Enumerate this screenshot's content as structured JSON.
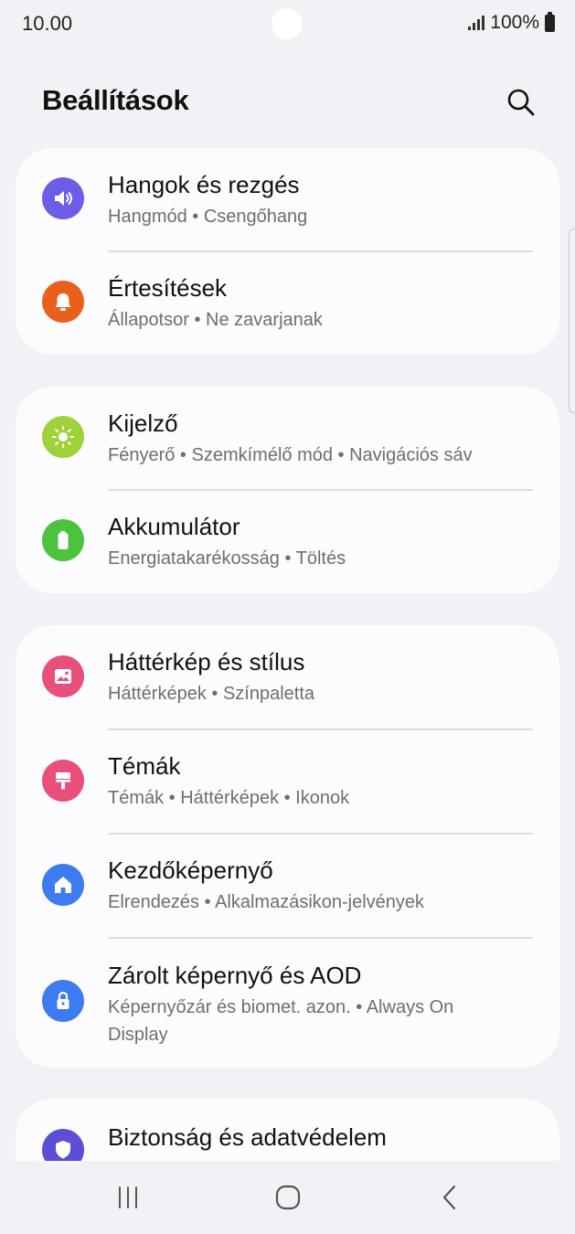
{
  "status_bar": {
    "time": "10.00",
    "battery": "100%"
  },
  "header": {
    "title": "Beállítások"
  },
  "groups": [
    {
      "items": [
        {
          "title": "Hangok és rezgés",
          "subtitle": "Hangmód  •  Csengőhang",
          "icon": "volume-icon",
          "color": "#6c5ce7"
        },
        {
          "title": "Értesítések",
          "subtitle": "Állapotsor  •  Ne zavarjanak",
          "icon": "bell-icon",
          "color": "#e8601c"
        }
      ]
    },
    {
      "items": [
        {
          "title": "Kijelző",
          "subtitle": "Fényerő  •  Szemkímélő mód  •  Navigációs sáv",
          "icon": "brightness-icon",
          "color": "#9fd23a"
        },
        {
          "title": "Akkumulátor",
          "subtitle": "Energiatakarékosság  •  Töltés",
          "icon": "battery-icon",
          "color": "#4cc23e"
        }
      ]
    },
    {
      "items": [
        {
          "title": "Háttérkép és stílus",
          "subtitle": "Háttérképek  •  Színpaletta",
          "icon": "image-icon",
          "color": "#e84f7a"
        },
        {
          "title": "Témák",
          "subtitle": "Témák  •  Háttérképek  •  Ikonok",
          "icon": "paintbrush-icon",
          "color": "#e84f7a"
        },
        {
          "title": "Kezdőképernyő",
          "subtitle": "Elrendezés  •  Alkalmazásikon-jelvények",
          "icon": "home-icon",
          "color": "#3d7cf0"
        },
        {
          "title": "Zárolt képernyő és AOD",
          "subtitle": "Képernyőzár és biomet. azon.  •  Always On Display",
          "icon": "lock-icon",
          "color": "#3d7cf0"
        }
      ]
    },
    {
      "items": [
        {
          "title": "Biztonság és adatvédelem",
          "icon": "shield-icon",
          "color": "#5a4fd6"
        }
      ]
    }
  ],
  "navigation": {
    "recents": "recents-icon",
    "home": "home-nav-icon",
    "back": "back-icon"
  }
}
